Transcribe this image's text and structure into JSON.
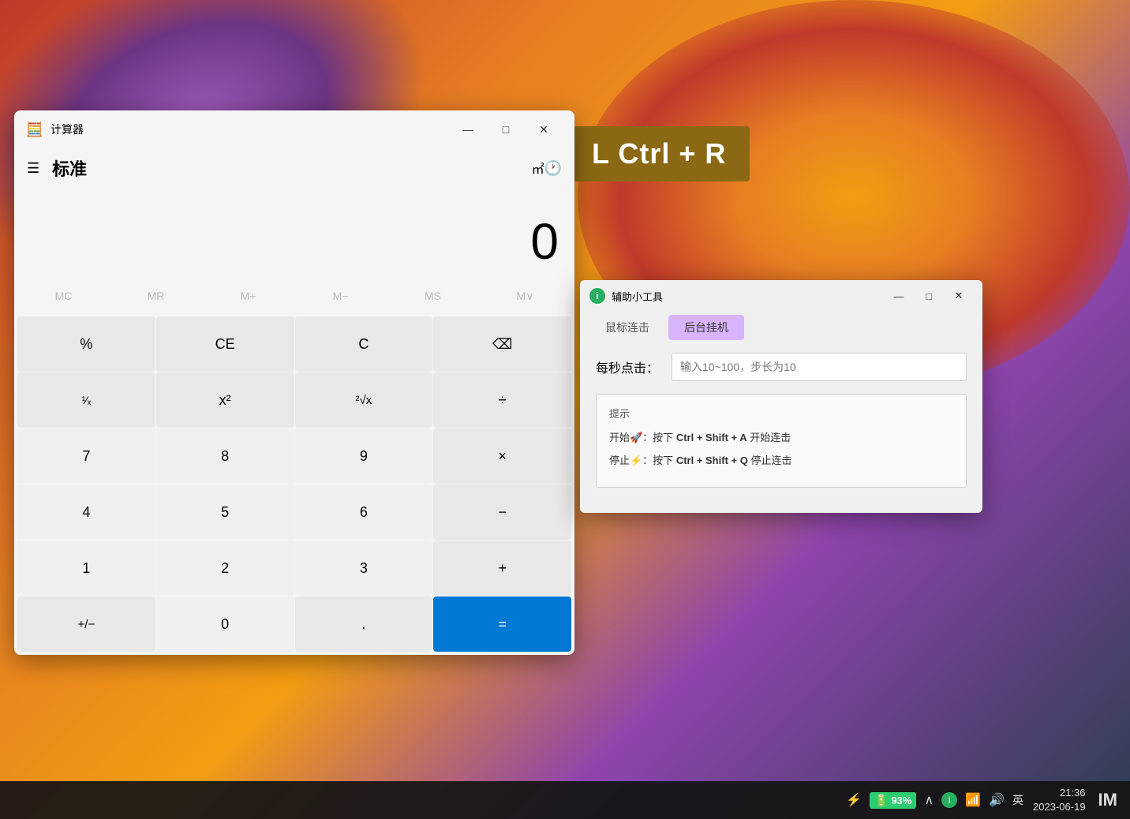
{
  "desktop": {
    "shortcut_label": "L Ctrl + R"
  },
  "calculator": {
    "title": "计算器",
    "mode": "标准",
    "mode_icon": "㎡",
    "display_value": "0",
    "titlebar": {
      "minimize": "—",
      "maximize": "□",
      "close": "✕"
    },
    "memory_buttons": [
      {
        "label": "MC",
        "disabled": true
      },
      {
        "label": "MR",
        "disabled": true
      },
      {
        "label": "M+",
        "disabled": true
      },
      {
        "label": "M−",
        "disabled": true
      },
      {
        "label": "MS",
        "disabled": true
      },
      {
        "label": "M∨",
        "disabled": true
      }
    ],
    "buttons": [
      {
        "label": "%",
        "type": "op"
      },
      {
        "label": "CE",
        "type": "op"
      },
      {
        "label": "C",
        "type": "op"
      },
      {
        "label": "⌫",
        "type": "op"
      },
      {
        "label": "¹⁄ₓ",
        "type": "op"
      },
      {
        "label": "x²",
        "type": "op"
      },
      {
        "label": "²√x",
        "type": "op"
      },
      {
        "label": "÷",
        "type": "op"
      },
      {
        "label": "7",
        "type": "num"
      },
      {
        "label": "8",
        "type": "num"
      },
      {
        "label": "9",
        "type": "num"
      },
      {
        "label": "×",
        "type": "op"
      },
      {
        "label": "4",
        "type": "num"
      },
      {
        "label": "5",
        "type": "num"
      },
      {
        "label": "6",
        "type": "num"
      },
      {
        "label": "−",
        "type": "op"
      },
      {
        "label": "1",
        "type": "num"
      },
      {
        "label": "2",
        "type": "num"
      },
      {
        "label": "3",
        "type": "num"
      },
      {
        "label": "+",
        "type": "op"
      },
      {
        "label": "+/−",
        "type": "op"
      },
      {
        "label": "0",
        "type": "num"
      },
      {
        "label": ".",
        "type": "op"
      },
      {
        "label": "=",
        "type": "equals"
      }
    ]
  },
  "helper": {
    "title": "辅助小工具",
    "tabs": [
      {
        "label": "鼠标连击",
        "active": false
      },
      {
        "label": "后台挂机",
        "active": true
      }
    ],
    "clicks_label": "每秒点击：",
    "input_placeholder": "输入10~100，步长为10",
    "tips_title": "提示",
    "tip_start": "开始🚀：按下 Ctrl + Shift + A 开始连击",
    "tip_stop": "停止⚡：按下 Ctrl + Shift + Q 停止连击",
    "titlebar": {
      "minimize": "—",
      "maximize": "□",
      "close": "✕"
    }
  },
  "taskbar": {
    "battery_icon": "⚡",
    "battery_level": "93%",
    "language": "英",
    "time": "21:36",
    "date": "2023-06-19",
    "logo": "IM"
  }
}
